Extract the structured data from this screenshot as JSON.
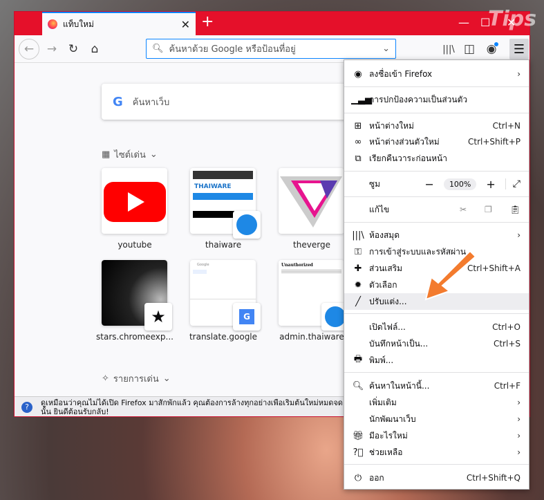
{
  "window": {
    "tab_title": "แท็บใหม่",
    "new_tab": "+",
    "minimize": "—",
    "maximize": "☐",
    "close": "✕"
  },
  "watermark": "Tips THAIWARE",
  "toolbar": {
    "url_placeholder": "ค้นหาด้วย Google หรือป้อนที่อยู่"
  },
  "content": {
    "search_placeholder": "ค้นหาเว็บ",
    "top_sites_label": "ไซต์เด่น",
    "highlights_label": "รายการเด่น",
    "tiles": [
      {
        "label": "youtube"
      },
      {
        "label": "thaiware"
      },
      {
        "label": "theverge"
      },
      {
        "label": "stars.chromeexp..."
      },
      {
        "label": "translate.google"
      },
      {
        "label": "admin.thaiware"
      }
    ],
    "notification": "ดูเหมือนว่าคุณไม่ได้เปิด Firefox มาสักพักแล้ว คุณต้องการล้างทุกอย่างเพื่อเริ่มต้นใหม่หมดจด นั้น ยินดีต้อนรับกลับ!"
  },
  "menu": {
    "sign_in": "ลงชื่อเข้า Firefox",
    "protections": "การปกป้องความเป็นส่วนตัว",
    "new_window": {
      "label": "หน้าต่างใหม่",
      "shortcut": "Ctrl+N"
    },
    "private_window": {
      "label": "หน้าต่างส่วนตัวใหม่",
      "shortcut": "Ctrl+Shift+P"
    },
    "restore": "เรียกคืนวาระก่อนหน้า",
    "zoom": {
      "label": "ซูม",
      "value": "100%"
    },
    "edit": "แก้ไข",
    "library": "ห้องสมุด",
    "logins": "การเข้าสู่ระบบและรหัสผ่าน",
    "addons": {
      "label": "ส่วนเสริม",
      "shortcut": "Ctrl+Shift+A"
    },
    "options": "ตัวเลือก",
    "customize": "ปรับแต่ง...",
    "open_file": {
      "label": "เปิดไฟล์...",
      "shortcut": "Ctrl+O"
    },
    "save_page": {
      "label": "บันทึกหน้าเป็น...",
      "shortcut": "Ctrl+S"
    },
    "print": "พิมพ์...",
    "find": {
      "label": "ค้นหาในหน้านี้...",
      "shortcut": "Ctrl+F"
    },
    "more": "เพิ่มเติม",
    "web_dev": "นักพัฒนาเว็บ",
    "whats_new": "มีอะไรใหม่",
    "help": "ช่วยเหลือ",
    "quit": {
      "label": "ออก",
      "shortcut": "Ctrl+Shift+Q"
    }
  },
  "colors": {
    "tabbar": "#e5102a",
    "accent": "#0a84ff",
    "arrow": "#f37b2e"
  }
}
